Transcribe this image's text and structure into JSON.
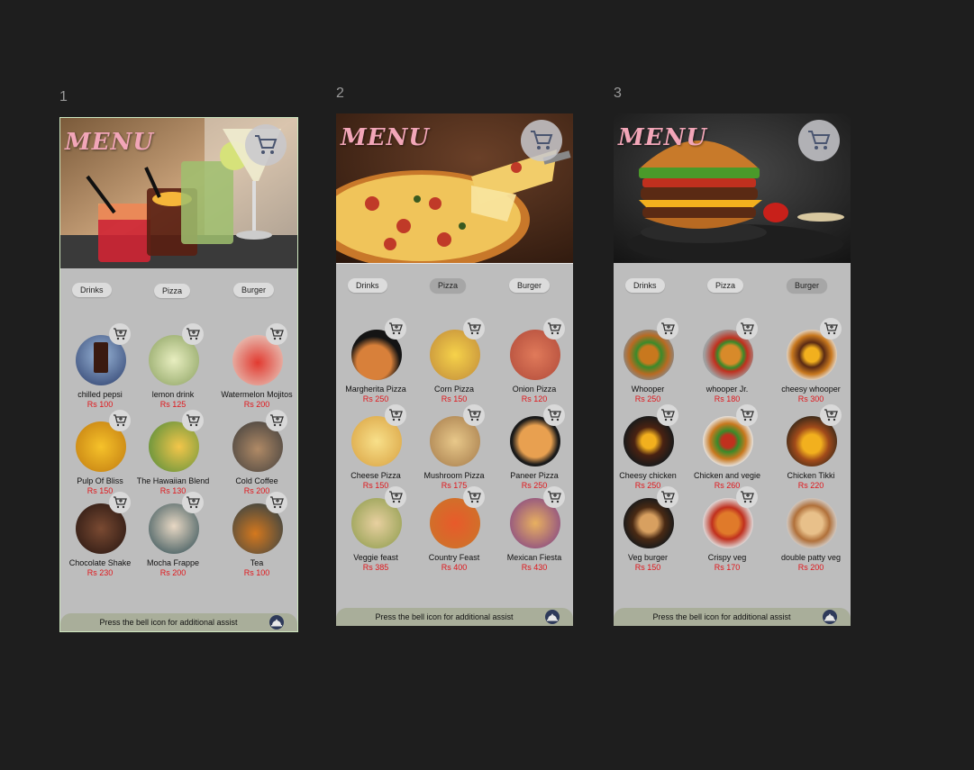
{
  "frames": [
    {
      "number": "1",
      "title": "MENU",
      "tabs": [
        "Drinks",
        "Pizza",
        "Burger"
      ],
      "footer_text": "Press the bell icon for additional assist",
      "items": [
        {
          "name": "chilled pepsi",
          "price": "Rs 100"
        },
        {
          "name": "lemon drink",
          "price": "Rs 125"
        },
        {
          "name": "Watermelon Mojitos",
          "price": "Rs 200"
        },
        {
          "name": "Pulp Of Bliss",
          "price": "Rs 150"
        },
        {
          "name": "The Hawaiian Blend",
          "price": "Rs 130"
        },
        {
          "name": "Cold Coffee",
          "price": "Rs 200"
        },
        {
          "name": "Chocolate Shake",
          "price": "Rs 230"
        },
        {
          "name": "Mocha Frappe",
          "price": "Rs 200"
        },
        {
          "name": "Tea",
          "price": "Rs 100"
        }
      ]
    },
    {
      "number": "2",
      "title": "MENU",
      "tabs": [
        "Drinks",
        "Pizza",
        "Burger"
      ],
      "footer_text": "Press the bell icon for additional assist",
      "items": [
        {
          "name": "Margherita Pizza",
          "price": "Rs 250"
        },
        {
          "name": "Corn Pizza",
          "price": "Rs 150"
        },
        {
          "name": "Onion Pizza",
          "price": "Rs 120"
        },
        {
          "name": "Cheese Pizza",
          "price": "Rs 150"
        },
        {
          "name": "Mushroom Pizza",
          "price": "Rs 175"
        },
        {
          "name": "Paneer Pizza",
          "price": "Rs 250"
        },
        {
          "name": "Veggie feast",
          "price": "Rs 385"
        },
        {
          "name": "Country Feast",
          "price": "Rs 400"
        },
        {
          "name": "Mexican Fiesta",
          "price": "Rs 430"
        }
      ]
    },
    {
      "number": "3",
      "title": "MENU",
      "tabs": [
        "Drinks",
        "Pizza",
        "Burger"
      ],
      "footer_text": "Press the bell icon for additional assist",
      "items": [
        {
          "name": "Whooper",
          "price": "Rs 250"
        },
        {
          "name": "whooper Jr.",
          "price": "Rs 180"
        },
        {
          "name": "cheesy whooper",
          "price": "Rs 300"
        },
        {
          "name": "Cheesy chicken",
          "price": "Rs 250"
        },
        {
          "name": "Chicken and vegie",
          "price": "Rs 260"
        },
        {
          "name": "Chicken Tikki",
          "price": "Rs 220"
        },
        {
          "name": "Veg burger",
          "price": "Rs 150"
        },
        {
          "name": "Crispy veg",
          "price": "Rs 170"
        },
        {
          "name": "double patty veg",
          "price": "Rs 200"
        }
      ]
    }
  ],
  "colors": {
    "canvas": "#1e1e1e",
    "screen_bg": "#bdbdbd",
    "price": "#e0161b",
    "menu_title": "#f2a6b8",
    "footer_bg": "#a9ae9a"
  },
  "icons": {
    "cart": "cart-icon",
    "add_to_cart": "add-to-cart-icon",
    "bell": "bell-icon"
  }
}
